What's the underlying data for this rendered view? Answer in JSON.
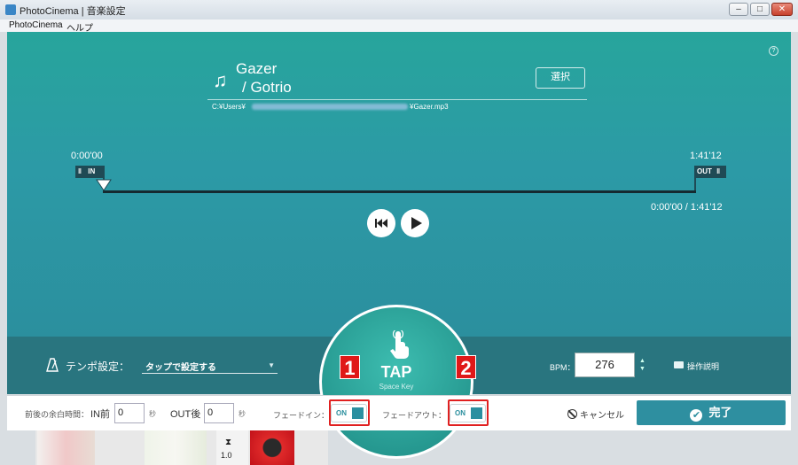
{
  "window": {
    "title": "PhotoCinema | 音楽設定",
    "controls": {
      "minimize": "–",
      "maximize": "□",
      "close": "✕"
    }
  },
  "menu": [
    "PhotoCinema",
    "ヘルプ"
  ],
  "song": {
    "title": "Gazer",
    "artist": "/ Gotrio",
    "select_label": "選択",
    "path_prefix": "C:¥Users¥",
    "path_suffix": "¥Gazer.mp3"
  },
  "timeline": {
    "in_time": "0:00'00",
    "out_time": "1:41'12",
    "in_tag": "IN",
    "out_tag": "OUT",
    "position": "0:00'00 / 1:41'12",
    "playhead_fraction": 0.0
  },
  "tempo": {
    "label": "テンポ設定：",
    "mode_value": "タップで設定する",
    "bpm_label": "BPM：",
    "bpm_value": "276",
    "guide_label": "操作説明"
  },
  "tap": {
    "label": "TAP",
    "sub": "Space Key"
  },
  "bottom": {
    "margin_label": "前後の余白時間：",
    "in_after_label": "IN前",
    "in_after_value": "0",
    "out_after_label": "OUT後",
    "out_after_value": "0",
    "unit": "秒",
    "fade_in_label": "フェードイン：",
    "fade_out_label": "フェードアウト：",
    "toggle_on": "ON",
    "cancel_label": "キャンセル",
    "done_label": "完了"
  },
  "annotations": {
    "badge1": "1",
    "badge2": "2"
  },
  "thumbs": {
    "count_label": "1.0"
  },
  "colors": {
    "accent": "#2b8f9e",
    "teal_bg": "#27a59c",
    "annotation_red": "#e02020"
  }
}
